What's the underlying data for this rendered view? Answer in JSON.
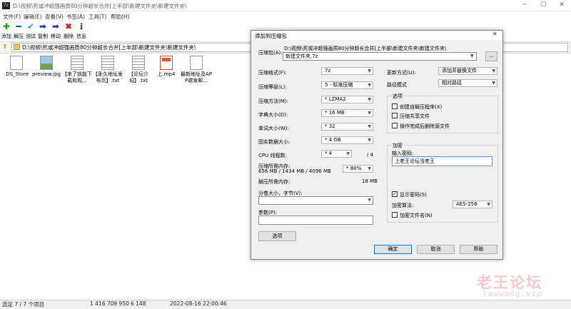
{
  "window": {
    "app_icon_text": "7z",
    "title": "D:\\视频\\死或冲超强画质80分钟超长合并[上半部\\新建文件夹\\新建文件夹\\"
  },
  "menu": [
    "文件(F)",
    "编辑(E)",
    "查看(V)",
    "书签(A)",
    "工具(T)",
    "帮助(H)"
  ],
  "toolbar": [
    {
      "label": "添加",
      "icon": "add-icon",
      "glyph": "✚",
      "color": "#16a016"
    },
    {
      "label": "解压",
      "icon": "extract-icon",
      "glyph": "━",
      "color": "#1e3fb4"
    },
    {
      "label": "测试",
      "icon": "test-icon",
      "glyph": "✔",
      "color": "#1ba9c9"
    },
    {
      "label": "复制",
      "icon": "copy-icon",
      "glyph": "➡",
      "color": "#1e3fb4"
    },
    {
      "label": "移动",
      "icon": "move-icon",
      "glyph": "➡",
      "color": "#1e3fb4"
    },
    {
      "label": "删除",
      "icon": "delete-icon",
      "glyph": "✖",
      "color": "#d01c1c"
    },
    {
      "label": "信息",
      "icon": "info-icon",
      "glyph": "ℹ",
      "color": "#1e3fb4"
    }
  ],
  "address": {
    "path": "D:\\视频\\死或冲超强画质80分钟超长合并[上半部\\新建文件夹\\新建文件夹\\"
  },
  "files": [
    {
      "name": ".DS_Store",
      "icon": "file-icon"
    },
    {
      "name": "preview.jpg",
      "icon": "image-icon"
    },
    {
      "name": "【来了就能下载和观...",
      "icon": "text-file-icon"
    },
    {
      "name": "【永久地址发布页】.txt",
      "icon": "text-file-icon"
    },
    {
      "name": "【论坛介绍】.txt",
      "icon": "text-file-icon"
    },
    {
      "name": "上.mp4",
      "icon": "video-file-icon"
    },
    {
      "name": "最新地址及APP邀发邮...",
      "icon": "file-icon"
    }
  ],
  "status": {
    "selection": "选定 7 / 7 个项目",
    "size": "1 416 709 950",
    "packed": "6 148",
    "modified": "2022-08-16 22:00:46"
  },
  "watermark": {
    "text": "老王论坛",
    "sub": "laowang.vip"
  },
  "dialog": {
    "title": "添加到压缩包",
    "close": "✕",
    "archive_label": "压缩包(A):",
    "archive_dir": "D:\\视频\\死或冲超强画质80分钟超长合并[上半部\\新建文件夹\\新建文件夹\\",
    "archive_name": "新建文件夹.7z",
    "browse": "...",
    "format_label": "压缩格式(F):",
    "format_value": "7z",
    "level_label": "压缩等级(L):",
    "level_value": "5 - 标准压缩",
    "method_label": "压缩方法(M):",
    "method_value": "* LZMA2",
    "dict_label": "字典大小(D):",
    "dict_value": "* 16 MB",
    "word_label": "单词大小(W):",
    "word_value": "* 32",
    "solid_label": "固实数据大小:",
    "solid_value": "* 4 GB",
    "cpu_label": "CPU 线程数:",
    "cpu_value": "* 4",
    "cpu_max": "/ 4",
    "mem_label": "压缩所需内存:",
    "mem_detail": "656 MB / 1434 MB / 4096 MB",
    "mem_pct": "* 80%",
    "decomp_label": "解压所需内存:",
    "decomp_value": "18 MB",
    "split_label": "分卷大小，字节(V):",
    "params_label": "参数(P):",
    "options_button": "选项",
    "update_label": "更新方式(U):",
    "update_value": "添加并替换文件",
    "path_label": "路径模式",
    "path_value": "相对路径",
    "options_group": "选项",
    "opt_sfx": "创建自解压程序(X)",
    "opt_shared": "压缩共享文件",
    "opt_delete": "操作完成后删除源文件",
    "enc_group": "加密",
    "pwd_label": "输入密码:",
    "pwd_value": "上老王论坛当老王",
    "show_pwd": "显示密码(S)",
    "enc_method_label": "加密算法:",
    "enc_method_value": "AES-256",
    "enc_names": "加密文件名(N)",
    "ok": "确定",
    "cancel": "取消",
    "help": "帮助"
  }
}
